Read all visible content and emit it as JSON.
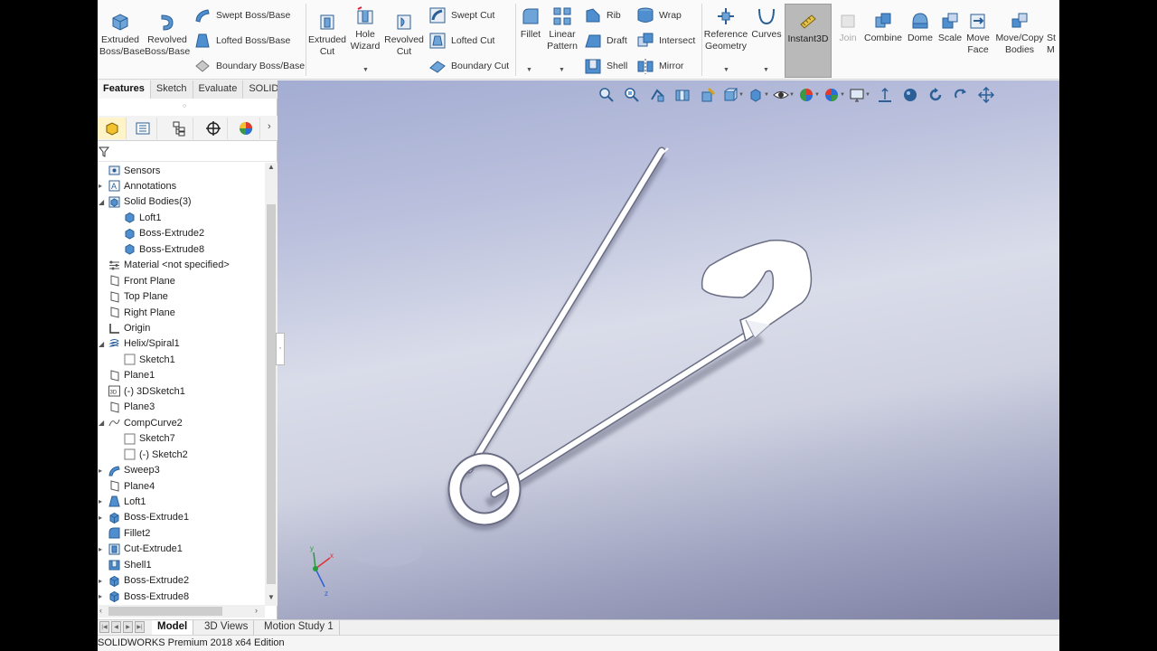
{
  "ribbon": {
    "extruded_boss": "Extruded\nBoss/Base",
    "revolved_boss": "Revolved\nBoss/Base",
    "swept_boss": "Swept Boss/Base",
    "lofted_boss": "Lofted Boss/Base",
    "boundary_boss": "Boundary Boss/Base",
    "extruded_cut": "Extruded\nCut",
    "hole_wizard": "Hole\nWizard",
    "revolved_cut": "Revolved\nCut",
    "swept_cut": "Swept Cut",
    "lofted_cut": "Lofted Cut",
    "boundary_cut": "Boundary Cut",
    "fillet": "Fillet",
    "linear_pattern": "Linear\nPattern",
    "rib": "Rib",
    "draft": "Draft",
    "shell": "Shell",
    "wrap": "Wrap",
    "intersect": "Intersect",
    "mirror": "Mirror",
    "reference_geometry": "Reference\nGeometry",
    "curves": "Curves",
    "instant3d": "Instant3D",
    "join": "Join",
    "combine": "Combine",
    "dome": "Dome",
    "scale": "Scale",
    "move_face": "Move\nFace",
    "move_copy": "Move/Copy\nBodies",
    "overflow": "St\nM"
  },
  "command_tabs": [
    "Features",
    "Sketch",
    "Evaluate",
    "SOLIDWORKS Add-Ins"
  ],
  "tree": {
    "items": [
      {
        "label": "Sensors",
        "icon": "sensor-icon",
        "expand": "",
        "indent": 0
      },
      {
        "label": "Annotations",
        "icon": "annotation-icon",
        "expand": "collapsed",
        "indent": 0
      },
      {
        "label": "Solid Bodies(3)",
        "icon": "solid-bodies-icon",
        "expand": "expanded",
        "indent": 0
      },
      {
        "label": "Loft1",
        "icon": "body-icon",
        "expand": "",
        "indent": 1
      },
      {
        "label": "Boss-Extrude2",
        "icon": "body-icon",
        "expand": "",
        "indent": 1
      },
      {
        "label": "Boss-Extrude8",
        "icon": "body-icon",
        "expand": "",
        "indent": 1
      },
      {
        "label": "Material <not specified>",
        "icon": "material-icon",
        "expand": "",
        "indent": 0
      },
      {
        "label": "Front Plane",
        "icon": "plane-icon",
        "expand": "",
        "indent": 0
      },
      {
        "label": "Top Plane",
        "icon": "plane-icon",
        "expand": "",
        "indent": 0
      },
      {
        "label": "Right Plane",
        "icon": "plane-icon",
        "expand": "",
        "indent": 0
      },
      {
        "label": "Origin",
        "icon": "origin-icon",
        "expand": "",
        "indent": 0
      },
      {
        "label": "Helix/Spiral1",
        "icon": "helix-icon",
        "expand": "expanded",
        "indent": 0
      },
      {
        "label": "Sketch1",
        "icon": "sketch-icon",
        "expand": "",
        "indent": 1
      },
      {
        "label": "Plane1",
        "icon": "plane-icon",
        "expand": "",
        "indent": 0
      },
      {
        "label": "(-) 3DSketch1",
        "icon": "3dsketch-icon",
        "expand": "",
        "indent": 0
      },
      {
        "label": "Plane3",
        "icon": "plane-icon",
        "expand": "",
        "indent": 0
      },
      {
        "label": "CompCurve2",
        "icon": "curve-icon",
        "expand": "expanded",
        "indent": 0
      },
      {
        "label": "Sketch7",
        "icon": "sketch-icon",
        "expand": "",
        "indent": 1
      },
      {
        "label": "(-) Sketch2",
        "icon": "sketch-icon",
        "expand": "",
        "indent": 1
      },
      {
        "label": "Sweep3",
        "icon": "sweep-icon",
        "expand": "collapsed",
        "indent": 0
      },
      {
        "label": "Plane4",
        "icon": "plane-icon",
        "expand": "",
        "indent": 0
      },
      {
        "label": "Loft1",
        "icon": "loft-icon",
        "expand": "collapsed",
        "indent": 0
      },
      {
        "label": "Boss-Extrude1",
        "icon": "extrude-icon",
        "expand": "collapsed",
        "indent": 0
      },
      {
        "label": "Fillet2",
        "icon": "fillet-icon",
        "expand": "",
        "indent": 0
      },
      {
        "label": "Cut-Extrude1",
        "icon": "cut-icon",
        "expand": "collapsed",
        "indent": 0
      },
      {
        "label": "Shell1",
        "icon": "shell-icon",
        "expand": "",
        "indent": 0
      },
      {
        "label": "Boss-Extrude2",
        "icon": "extrude-icon",
        "expand": "collapsed",
        "indent": 0
      },
      {
        "label": "Boss-Extrude8",
        "icon": "extrude-icon",
        "expand": "collapsed",
        "indent": 0
      }
    ]
  },
  "bottom_tabs": [
    "Model",
    "3D Views",
    "Motion Study 1"
  ],
  "status": "SOLIDWORKS Premium 2018 x64 Edition",
  "colors": {
    "accent": "#fff3c8",
    "viewport_top": "#a3acd2",
    "viewport_bottom": "#7d80a2",
    "model": "#ffffff"
  }
}
